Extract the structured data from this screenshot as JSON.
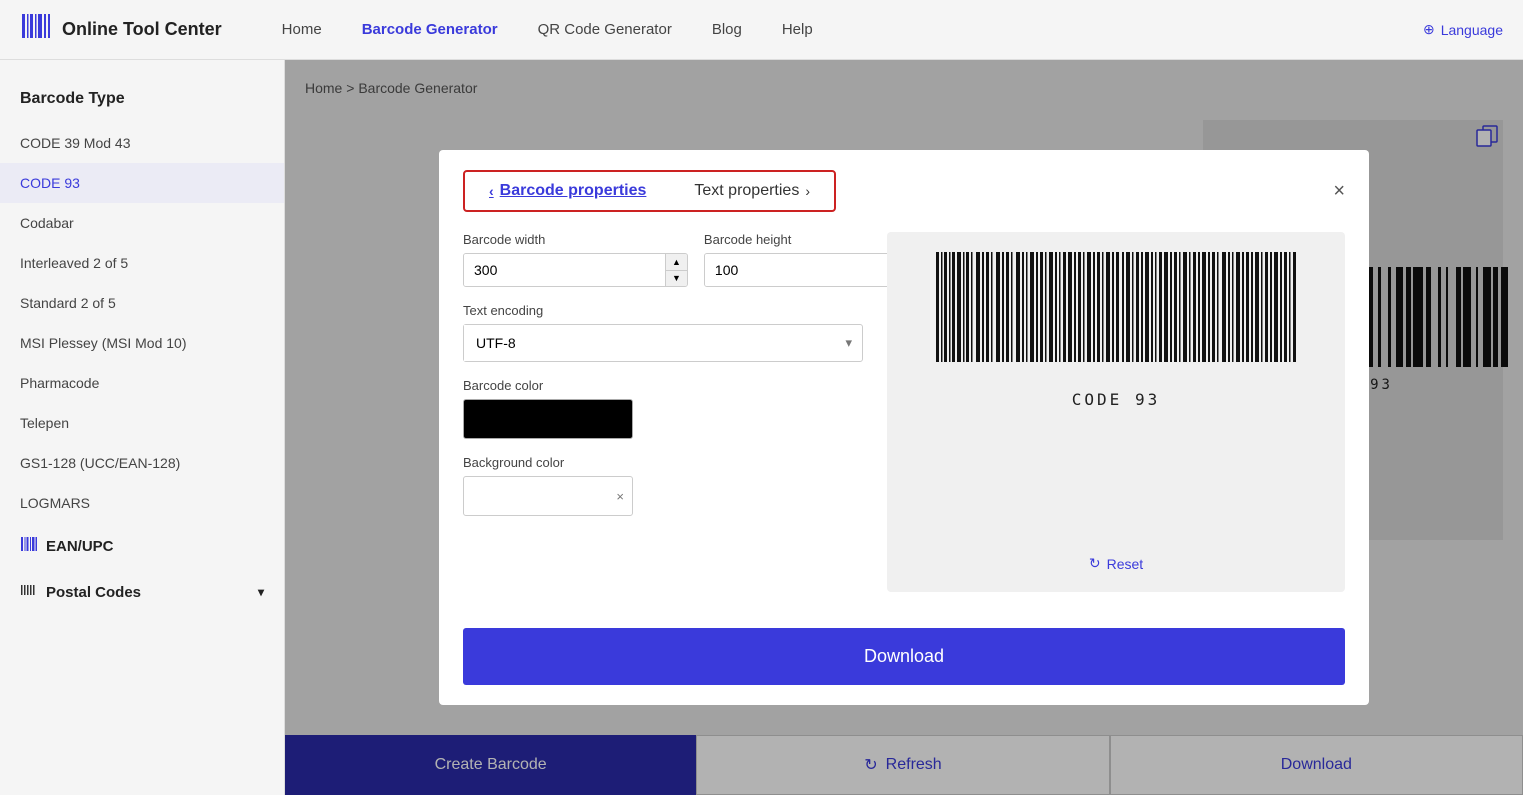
{
  "header": {
    "logo_icon": "▦",
    "logo_text": "Online Tool Center",
    "nav_items": [
      {
        "label": "Home",
        "active": false
      },
      {
        "label": "Barcode Generator",
        "active": true
      },
      {
        "label": "QR Code Generator",
        "active": false
      },
      {
        "label": "Blog",
        "active": false
      },
      {
        "label": "Help",
        "active": false
      }
    ],
    "language_label": "Language"
  },
  "sidebar": {
    "heading": "Barcode Type",
    "items": [
      {
        "label": "CODE 39 Mod 43",
        "active": false
      },
      {
        "label": "CODE 93",
        "active": true
      },
      {
        "label": "Codabar",
        "active": false
      },
      {
        "label": "Interleaved 2 of 5",
        "active": false
      },
      {
        "label": "Standard 2 of 5",
        "active": false
      },
      {
        "label": "MSI Plessey (MSI Mod 10)",
        "active": false
      },
      {
        "label": "Pharmacode",
        "active": false
      },
      {
        "label": "Telepen",
        "active": false
      },
      {
        "label": "GS1-128 (UCC/EAN-128)",
        "active": false
      },
      {
        "label": "LOGMARS",
        "active": false
      }
    ],
    "sections": [
      {
        "label": "EAN/UPC",
        "icon": "▦"
      },
      {
        "label": "Postal Codes",
        "icon": "|||"
      }
    ]
  },
  "breadcrumb": {
    "home": "Home",
    "separator": " > ",
    "current": "Barcode Generator"
  },
  "modal": {
    "tab_barcode": "Barcode properties",
    "tab_text": "Text properties",
    "close_label": "×",
    "form": {
      "barcode_width_label": "Barcode width",
      "barcode_width_value": "300",
      "barcode_height_label": "Barcode height",
      "barcode_height_value": "100",
      "text_encoding_label": "Text encoding",
      "text_encoding_value": "UTF-8",
      "barcode_color_label": "Barcode color",
      "background_color_label": "Background color",
      "clear_icon": "×"
    },
    "reset_label": "Reset",
    "download_label": "Download",
    "barcode_text": "CODE 93"
  },
  "bottom_buttons": {
    "create_label": "Create Barcode",
    "refresh_label": "Refresh",
    "download_label": "Download"
  },
  "icons": {
    "globe": "⊕",
    "copy": "⧉",
    "reset": "↻",
    "chevron_left": "<",
    "chevron_right": ">",
    "chevron_down": "▾",
    "spinner_up": "▲",
    "spinner_down": "▼"
  }
}
